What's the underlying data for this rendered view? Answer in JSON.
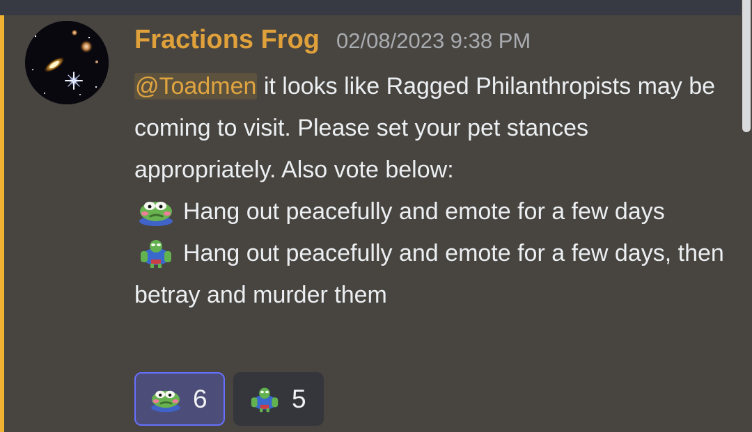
{
  "message": {
    "author": "Fractions Frog",
    "timestamp": "02/08/2023 9:38 PM",
    "mention": "@Toadmen",
    "intro_text": " it looks like Ragged Philanthropists may be coming to visit. Please set your pet stances appropriately. Also vote below:",
    "options": [
      {
        "icon": "sad-frog-emoji",
        "text": "Hang out peacefully and emote for a few days"
      },
      {
        "icon": "buff-frog-emoji",
        "text": "Hang out peacefully and emote for a few days, then betray and murder them"
      }
    ]
  },
  "reactions": [
    {
      "icon": "sad-frog-emoji",
      "count": "6",
      "selected": true
    },
    {
      "icon": "buff-frog-emoji",
      "count": "5",
      "selected": false
    }
  ],
  "colors": {
    "background": "#484540",
    "top_strip": "#373a42",
    "highlight_bar": "#f0b232",
    "author": "#e0a13b",
    "timestamp": "#a8abb0",
    "text": "#eceff2",
    "mention": "#e1a540",
    "reaction_active_bg": "#4c4d78",
    "reaction_active_border": "#6670ff",
    "reaction_inactive_bg": "#34363c"
  }
}
